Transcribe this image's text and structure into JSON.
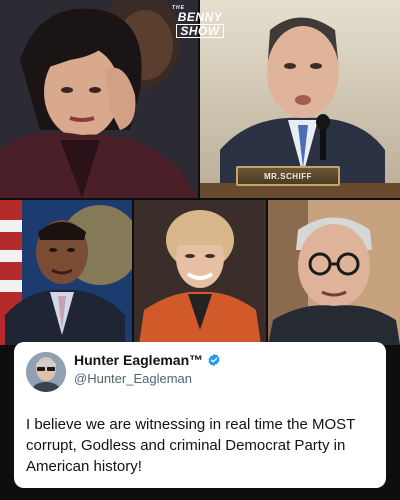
{
  "overlay": {
    "logo_the": "THE",
    "logo_line1": "BENNY",
    "logo_line2": "SHOW",
    "nameplate": "MR.SCHIFF"
  },
  "tweet": {
    "display_name": "Hunter Eagleman™",
    "handle": "@Hunter_Eagleman",
    "verified": true,
    "text": "I believe we are witnessing in real time the MOST corrupt, Godless and criminal Democrat Party in American history!"
  },
  "colors": {
    "verified_badge": "#1d9bf0",
    "card_bg": "#ffffff",
    "handle_text": "#536471"
  }
}
